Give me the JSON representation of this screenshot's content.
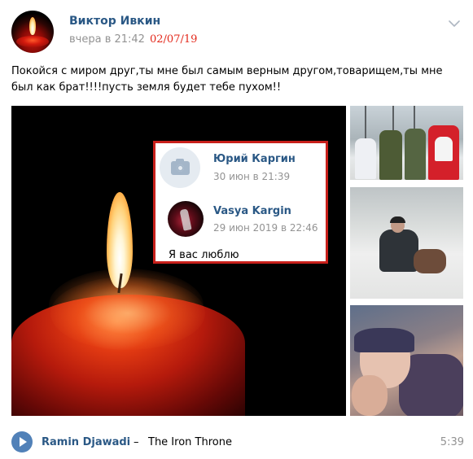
{
  "post": {
    "author": "Виктор Ивкин",
    "time": "вчера в 21:42",
    "date_stamp": "02/07/19",
    "text": "Покойся с миром друг,ты мне был самым верным другом,товарищем,ты мне был как брат!!!!пусть земля будет тебе пухом!!",
    "menu_icon": "chevron-down-icon"
  },
  "comments": [
    {
      "name": "Юрий Каргин",
      "time": "30 июн в 21:39",
      "avatar": "camera-icon"
    },
    {
      "name": "Vasya Kargin",
      "time": "29 июн 2019 в 22:46",
      "text": "Я вас люблю"
    }
  ],
  "audio": {
    "artist": "Ramin Djawadi",
    "separator": "–",
    "title": "The Iron Throne",
    "duration": "5:39",
    "play_icon": "play-icon"
  },
  "colors": {
    "link": "#2a5885",
    "muted": "#939393",
    "highlight_border": "#c8201b",
    "stamp": "#e3281b",
    "play_button": "#5181b8"
  }
}
